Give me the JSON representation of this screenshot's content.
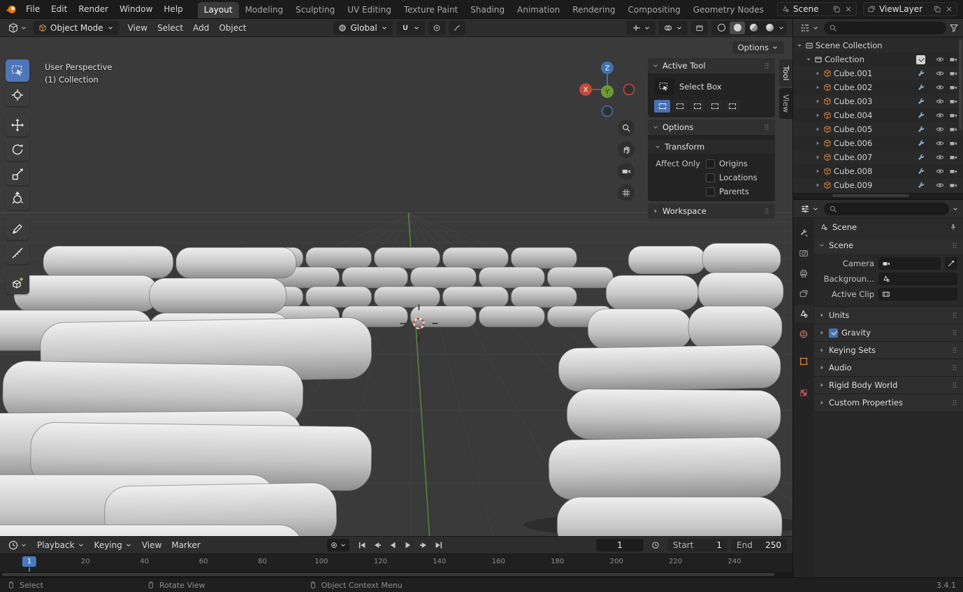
{
  "topbar": {
    "menus": [
      "File",
      "Edit",
      "Render",
      "Window",
      "Help"
    ],
    "workspaces": [
      "Layout",
      "Modeling",
      "Sculpting",
      "UV Editing",
      "Texture Paint",
      "Shading",
      "Animation",
      "Rendering",
      "Compositing",
      "Geometry Nodes"
    ],
    "active_workspace": "Layout",
    "scene": {
      "label": "Scene"
    },
    "viewlayer": {
      "label": "ViewLayer"
    }
  },
  "viewport_header": {
    "mode": "Object Mode",
    "menus": [
      "View",
      "Select",
      "Add",
      "Object"
    ],
    "orientation": "Global",
    "options_button": "Options"
  },
  "viewport": {
    "perspective_label": "User Perspective",
    "collection_label": "(1) Collection",
    "gizmo": {
      "x": "X",
      "y": "Y",
      "z": "Z"
    },
    "side_tabs": [
      "Tool",
      "View"
    ],
    "active_side_tab": "Tool"
  },
  "tool_panel": {
    "active_tool_title": "Active Tool",
    "tool_name": "Select Box",
    "options_title": "Options",
    "transform_label": "Transform",
    "affect_only_label": "Affect Only",
    "affect_options": [
      "Origins",
      "Locations",
      "Parents"
    ],
    "workspace_title": "Workspace"
  },
  "outliner": {
    "search_placeholder": "",
    "rows": [
      {
        "label": "Scene Collection",
        "type": "scene-collection",
        "indent": 0,
        "expanded": true
      },
      {
        "label": "Collection",
        "type": "collection",
        "indent": 1,
        "expanded": true,
        "checkbox": true
      },
      {
        "label": "Cube.001",
        "type": "mesh",
        "indent": 2
      },
      {
        "label": "Cube.002",
        "type": "mesh",
        "indent": 2
      },
      {
        "label": "Cube.003",
        "type": "mesh",
        "indent": 2
      },
      {
        "label": "Cube.004",
        "type": "mesh",
        "indent": 2
      },
      {
        "label": "Cube.005",
        "type": "mesh",
        "indent": 2
      },
      {
        "label": "Cube.006",
        "type": "mesh",
        "indent": 2
      },
      {
        "label": "Cube.007",
        "type": "mesh",
        "indent": 2
      },
      {
        "label": "Cube.008",
        "type": "mesh",
        "indent": 2
      },
      {
        "label": "Cube.009",
        "type": "mesh",
        "indent": 2
      }
    ]
  },
  "properties": {
    "breadcrumb": "Scene",
    "search_placeholder": "",
    "scene_section": {
      "title": "Scene",
      "fields": [
        {
          "label": "Camera",
          "icon": "camera-icon",
          "picker": true
        },
        {
          "label": "Backgroun...",
          "icon": "scene-icon"
        },
        {
          "label": "Active Clip",
          "icon": "film-icon"
        }
      ]
    },
    "sections": [
      {
        "title": "Units"
      },
      {
        "title": "Gravity",
        "checkbox": true,
        "checked": true
      },
      {
        "title": "Keying Sets"
      },
      {
        "title": "Audio"
      },
      {
        "title": "Rigid Body World"
      },
      {
        "title": "Custom Properties"
      }
    ]
  },
  "timeline": {
    "menus": [
      {
        "label": "Playback",
        "dropdown": true
      },
      {
        "label": "Keying",
        "dropdown": true
      },
      {
        "label": "View"
      },
      {
        "label": "Marker"
      }
    ],
    "current_frame": "1",
    "start_label": "Start",
    "start_value": "1",
    "end_label": "End",
    "end_value": "250",
    "ticks": [
      1,
      20,
      40,
      60,
      80,
      100,
      120,
      140,
      160,
      180,
      200,
      220,
      240
    ]
  },
  "statusbar": {
    "hints": [
      "Select",
      "Rotate View",
      "Object Context Menu"
    ],
    "version": "3.4.1"
  }
}
